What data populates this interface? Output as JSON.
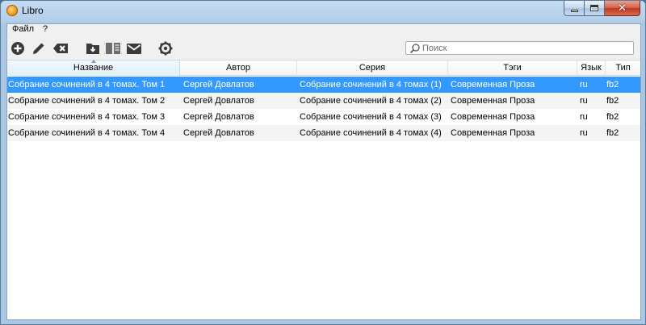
{
  "window": {
    "title": "Libro"
  },
  "menu": {
    "items": [
      "Файл",
      "?"
    ]
  },
  "toolbar": {
    "buttons": [
      {
        "icon": "add-icon"
      },
      {
        "icon": "edit-icon"
      },
      {
        "icon": "delete-icon"
      },
      {
        "icon": "import-icon"
      },
      {
        "icon": "reader-icon"
      },
      {
        "icon": "mail-icon"
      },
      {
        "icon": "settings-icon"
      }
    ]
  },
  "search": {
    "placeholder": "Поиск",
    "value": ""
  },
  "table": {
    "columns": [
      "Название",
      "Автор",
      "Серия",
      "Тэги",
      "Язык",
      "Тип"
    ],
    "sorted_column": "Название",
    "rows": [
      {
        "title": "Собрание сочинений в 4 томах. Том 1",
        "author": "Сергей Довлатов",
        "series": "Собрание сочинений в 4 томах (1)",
        "tags": "Современная Проза",
        "lang": "ru",
        "type": "fb2"
      },
      {
        "title": "Собрание сочинений в 4 томах. Том 2",
        "author": "Сергей Довлатов",
        "series": "Собрание сочинений в 4 томах (2)",
        "tags": "Современная Проза",
        "lang": "ru",
        "type": "fb2"
      },
      {
        "title": "Собрание сочинений в 4 томах. Том 3",
        "author": "Сергей Довлатов",
        "series": "Собрание сочинений в 4 томах (3)",
        "tags": "Современная Проза",
        "lang": "ru",
        "type": "fb2"
      },
      {
        "title": "Собрание сочинений в 4 томах. Том 4",
        "author": "Сергей Довлатов",
        "series": "Собрание сочинений в 4 томах (4)",
        "tags": "Современная Проза",
        "lang": "ru",
        "type": "fb2"
      }
    ],
    "selected_row": 0
  },
  "colors": {
    "selection": "#3399ff",
    "title_bar": "#b5cfe9",
    "close_button": "#c0391f"
  }
}
